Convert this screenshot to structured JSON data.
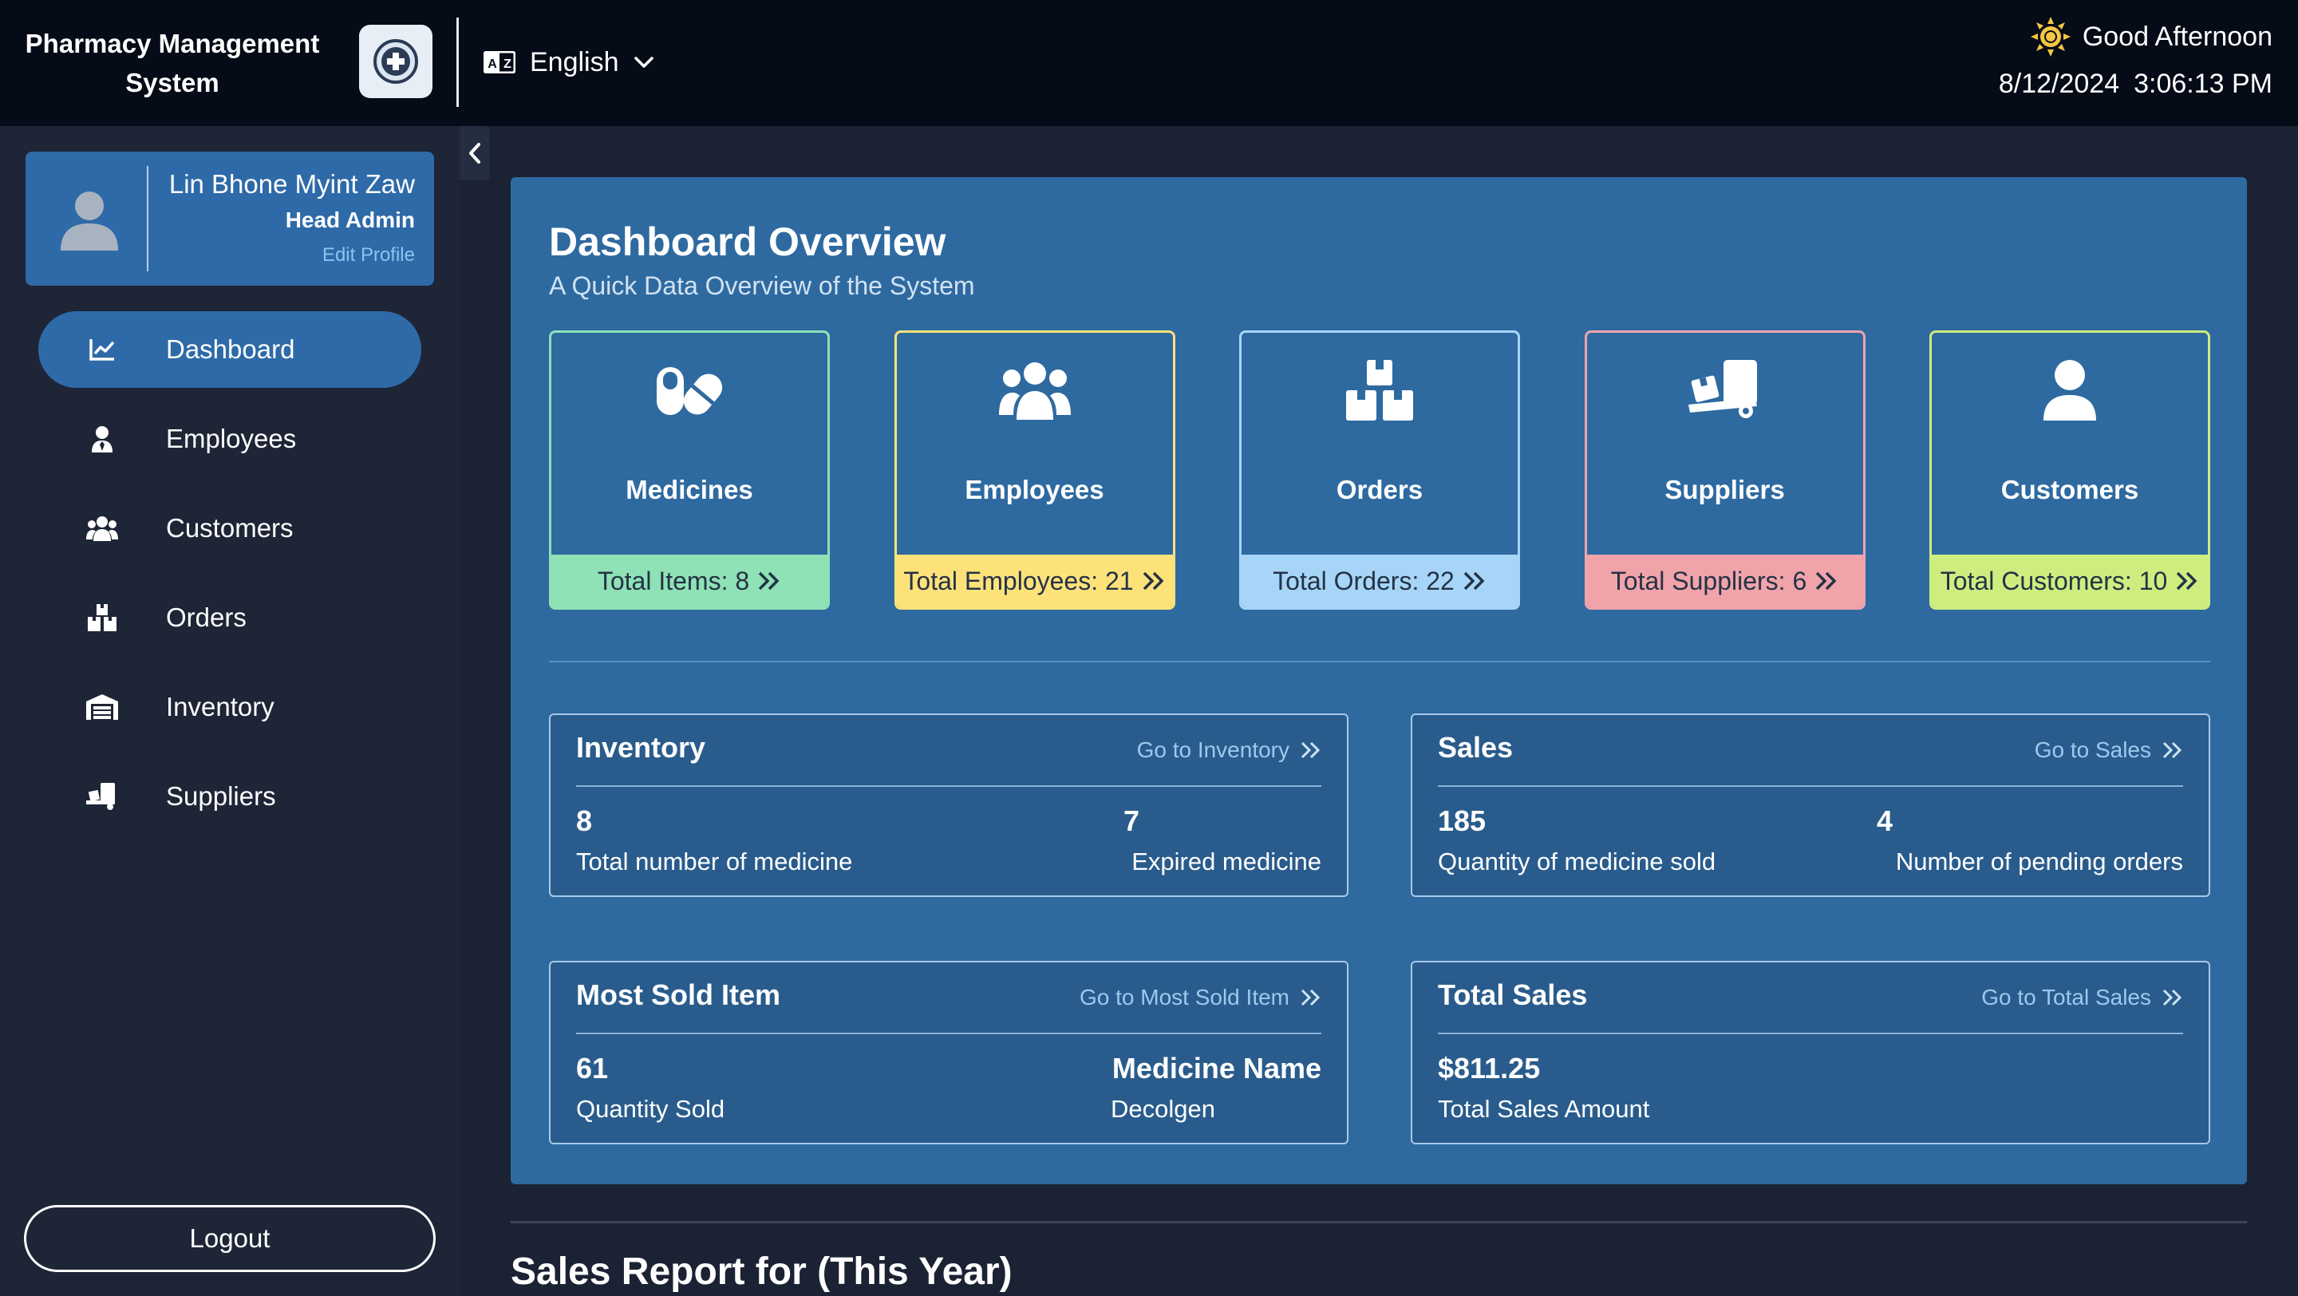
{
  "header": {
    "app_title": "Pharmacy Management System",
    "language": "English",
    "greeting": "Good Afternoon",
    "date": "8/12/2024",
    "time": "3:06:13 PM"
  },
  "profile": {
    "name": "Lin Bhone Myint Zaw",
    "role": "Head Admin",
    "edit_label": "Edit Profile"
  },
  "sidebar": {
    "items": [
      {
        "label": "Dashboard",
        "icon": "chart-line-icon",
        "active": true
      },
      {
        "label": "Employees",
        "icon": "user-tie-icon",
        "active": false
      },
      {
        "label": "Customers",
        "icon": "users-icon",
        "active": false
      },
      {
        "label": "Orders",
        "icon": "boxes-icon",
        "active": false
      },
      {
        "label": "Inventory",
        "icon": "warehouse-icon",
        "active": false
      },
      {
        "label": "Suppliers",
        "icon": "dolly-icon",
        "active": false
      }
    ],
    "logout_label": "Logout"
  },
  "overview": {
    "title": "Dashboard Overview",
    "subtitle": "A Quick Data Overview of the System",
    "cards": [
      {
        "label": "Medicines",
        "footer": "Total Items: 8",
        "icon": "pills-icon",
        "color": "#8ee2b6"
      },
      {
        "label": "Employees",
        "footer": "Total Employees: 21",
        "icon": "users-icon",
        "color": "#fde27a"
      },
      {
        "label": "Orders",
        "footer": "Total Orders: 22",
        "icon": "boxes-icon",
        "color": "#a6d5f7"
      },
      {
        "label": "Suppliers",
        "footer": "Total Suppliers: 6",
        "icon": "dolly-icon",
        "color": "#f0a4aa"
      },
      {
        "label": "Customers",
        "footer": "Total Customers: 10",
        "icon": "user-icon",
        "color": "#cdee7f"
      }
    ],
    "inventory": {
      "title": "Inventory",
      "link": "Go to Inventory",
      "left_value": "8",
      "left_label": "Total number of medicine",
      "right_value": "7",
      "right_label": "Expired medicine"
    },
    "sales": {
      "title": "Sales",
      "link": "Go to Sales",
      "left_value": "185",
      "left_label": "Quantity of medicine sold",
      "right_value": "4",
      "right_label": "Number of pending orders"
    },
    "most_sold": {
      "title": "Most Sold Item",
      "link": "Go to Most Sold Item",
      "left_value": "61",
      "left_label": "Quantity Sold",
      "right_value": "Medicine Name",
      "right_label": "Decolgen"
    },
    "total_sales": {
      "title": "Total Sales",
      "link": "Go to Total Sales",
      "left_value": "$811.25",
      "left_label": "Total Sales Amount"
    }
  },
  "report": {
    "title": "Sales Report for (This Year)"
  },
  "colors": {
    "topbar": "#050b17",
    "sidebar": "#1e2536",
    "accent": "#2e6aa8",
    "panel": "#2e6aa0"
  }
}
